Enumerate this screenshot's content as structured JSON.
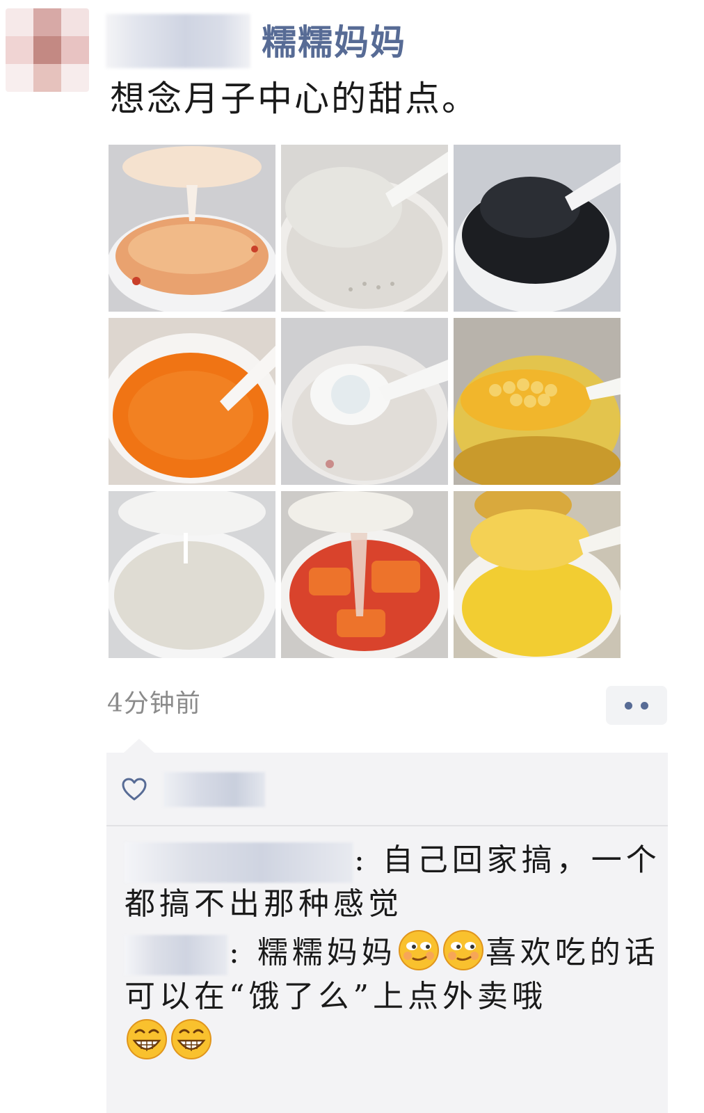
{
  "post": {
    "author_name": "糯糯妈妈",
    "text": "想念月子中心的甜点。",
    "time": "4分钟前"
  },
  "photos": [
    {
      "label": "dessert-1"
    },
    {
      "label": "dessert-2"
    },
    {
      "label": "dessert-3"
    },
    {
      "label": "dessert-4"
    },
    {
      "label": "dessert-5"
    },
    {
      "label": "dessert-6"
    },
    {
      "label": "dessert-7"
    },
    {
      "label": "dessert-8"
    },
    {
      "label": "dessert-9"
    }
  ],
  "comments": [
    {
      "sep": ": ",
      "text": "自己回家搞，一个都搞不出那种感觉"
    },
    {
      "sep": ": ",
      "text_before": "糯糯妈妈",
      "text_after": "喜欢吃的话可以在“饿了么”上点外卖哦"
    }
  ],
  "icons": {
    "more": "more-dots-icon",
    "like": "heart-icon",
    "emoji_smirk": "smirk-emoji-icon",
    "emoji_grin": "grin-emoji-icon"
  },
  "colors": {
    "link": "#576b95",
    "time": "#8b8b8b",
    "panel": "#f3f3f5"
  }
}
